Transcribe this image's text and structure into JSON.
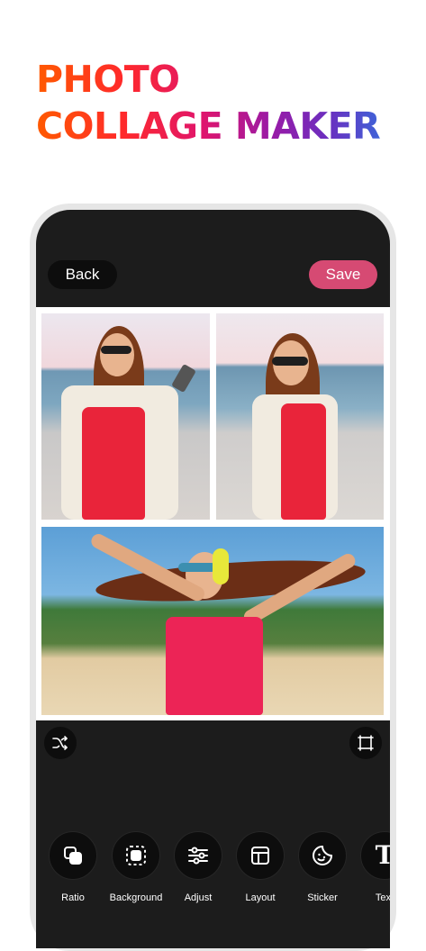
{
  "headline": {
    "line1": "PHOTO",
    "line2": "COLLAGE MAKER"
  },
  "topbar": {
    "back_label": "Back",
    "save_label": "Save",
    "save_color": "#d64a73"
  },
  "collage": {
    "photos": [
      {
        "subject": "woman-phone-pier"
      },
      {
        "subject": "woman-smiling-pier"
      },
      {
        "subject": "woman-headphones-beach"
      }
    ]
  },
  "controls": {
    "shuffle_icon": "shuffle-icon",
    "crop_icon": "crop-icon"
  },
  "tools": [
    {
      "label": "Ratio",
      "icon": "ratio-icon"
    },
    {
      "label": "Background",
      "icon": "background-icon"
    },
    {
      "label": "Adjust",
      "icon": "adjust-icon"
    },
    {
      "label": "Layout",
      "icon": "layout-icon"
    },
    {
      "label": "Sticker",
      "icon": "sticker-icon"
    },
    {
      "label": "Text",
      "icon": "text-icon"
    }
  ]
}
